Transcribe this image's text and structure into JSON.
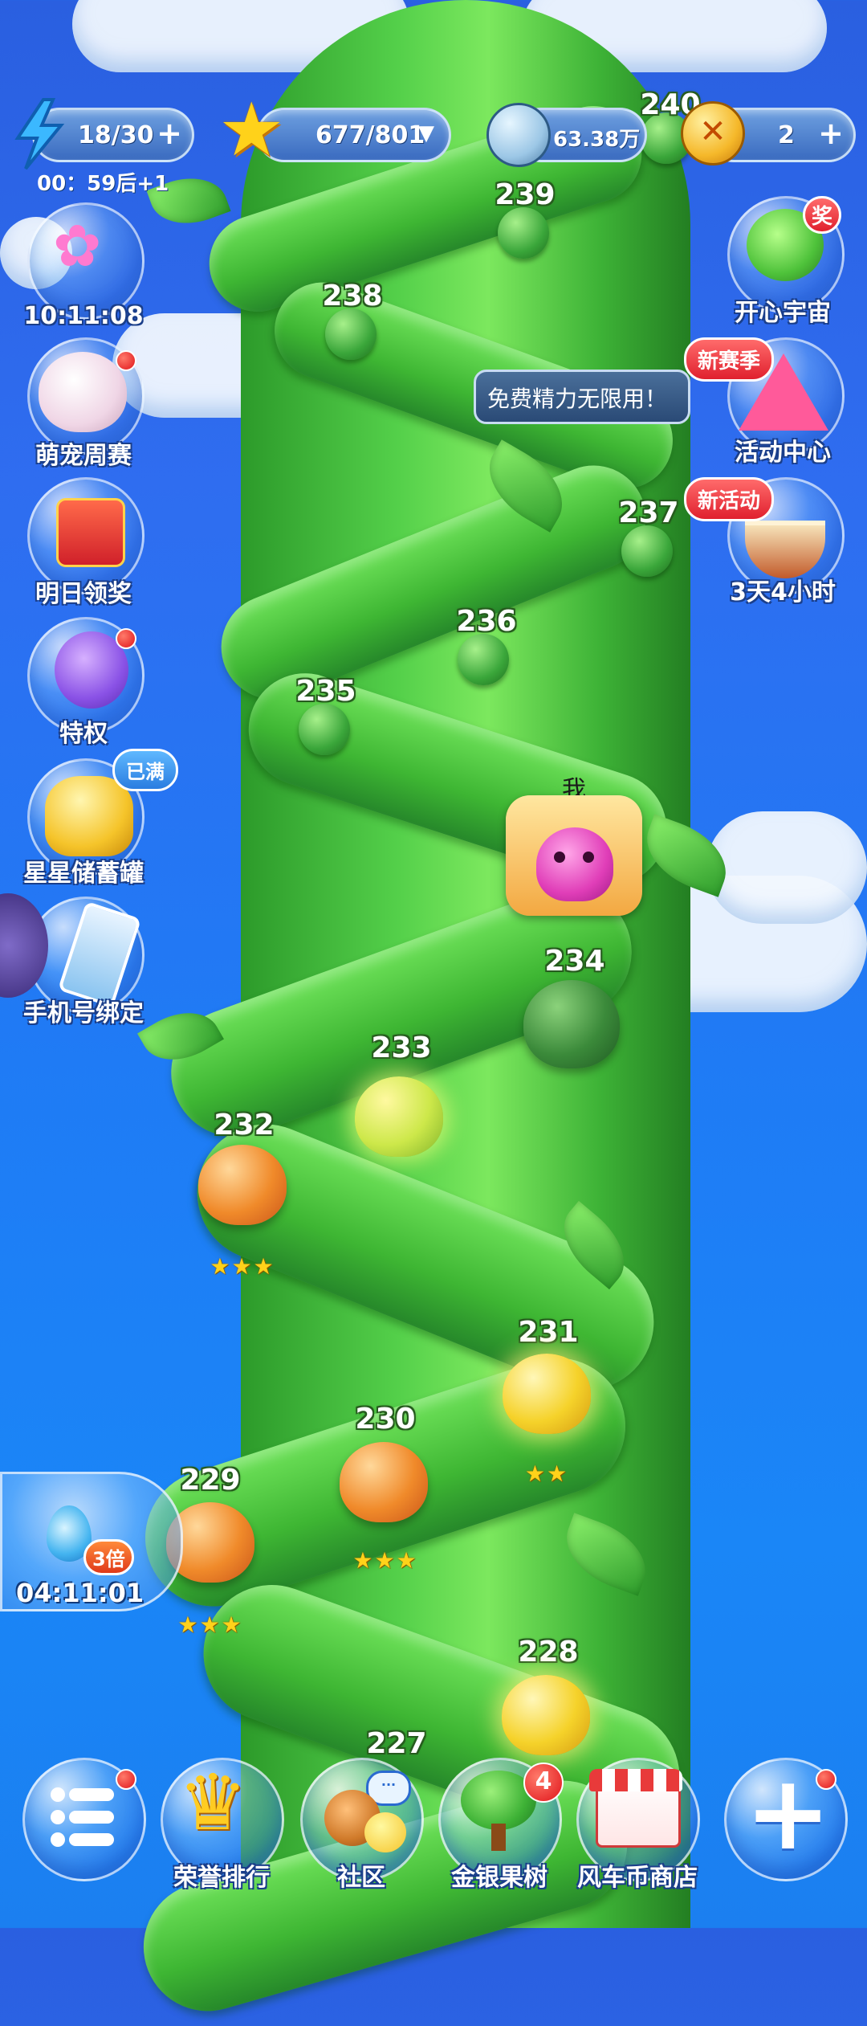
{
  "top_bar": {
    "energy": {
      "value": "18/30",
      "timer": "00：59后+1"
    },
    "stars": {
      "value": "677/801"
    },
    "coins": {
      "value": "63.38万"
    },
    "gold": {
      "value": "2"
    }
  },
  "left_sidebar": {
    "items": [
      {
        "label": "10:11:08"
      },
      {
        "label": "萌宠周赛"
      },
      {
        "label": "明日领奖"
      },
      {
        "label": "特权"
      },
      {
        "label": "星星储蓄罐",
        "badge": "已满"
      },
      {
        "label": "手机号绑定"
      }
    ]
  },
  "right_sidebar": {
    "items": [
      {
        "label": "开心宇宙",
        "badge": "奖"
      },
      {
        "label": "活动中心",
        "badge": "新赛季"
      },
      {
        "label": "3天4小时",
        "badge": "新活动"
      }
    ],
    "tooltip": "免费精力无限用！"
  },
  "player_marker": {
    "label": "我"
  },
  "levels": [
    {
      "num": "240"
    },
    {
      "num": "239"
    },
    {
      "num": "238"
    },
    {
      "num": "237"
    },
    {
      "num": "236"
    },
    {
      "num": "235"
    },
    {
      "num": "234"
    },
    {
      "num": "233"
    },
    {
      "num": "232",
      "stars": "★★★"
    },
    {
      "num": "231",
      "stars": "★★"
    },
    {
      "num": "230",
      "stars": "★★★"
    },
    {
      "num": "229",
      "stars": "★★★"
    },
    {
      "num": "228"
    },
    {
      "num": "227"
    }
  ],
  "water_boost": {
    "multiplier": "3倍",
    "timer": "04:11:01"
  },
  "bottom_bar": {
    "items": [
      {
        "label": ""
      },
      {
        "label": "荣誉排行"
      },
      {
        "label": "社区"
      },
      {
        "label": "金银果树",
        "badge": "4"
      },
      {
        "label": "风车币商店"
      },
      {
        "label": ""
      }
    ]
  },
  "icons": [
    "lightning-icon",
    "star-icon",
    "coin-icon",
    "gold-coin-icon",
    "plus-icon",
    "menu-icon",
    "crown-icon",
    "chat-icon",
    "tree-icon",
    "shop-icon"
  ]
}
